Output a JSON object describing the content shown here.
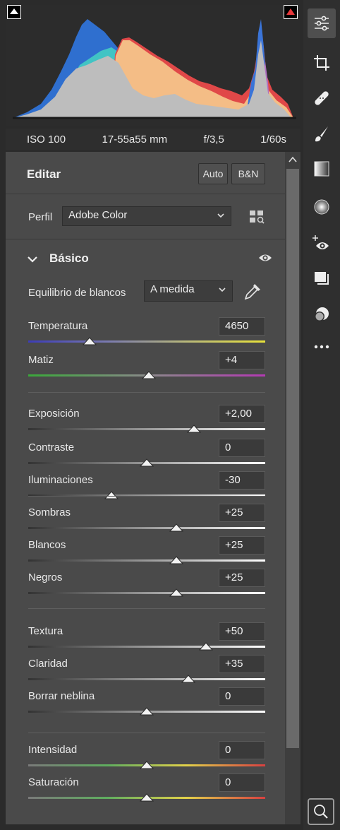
{
  "histogram": {
    "clip_shadow_icon": "triangle-icon",
    "clip_highlight_icon": "triangle-icon",
    "highlight_clip_color": "#e8383b"
  },
  "camera": {
    "iso": "ISO 100",
    "lens": "17-55a55 mm",
    "aperture": "f/3,5",
    "shutter": "1/60s"
  },
  "edit": {
    "title": "Editar",
    "auto_label": "Auto",
    "bw_label": "B&N"
  },
  "profile": {
    "label": "Perfil",
    "value": "Adobe Color"
  },
  "basic": {
    "title": "Básico",
    "wb_label": "Equilibrio de blancos",
    "wb_value": "A medida",
    "sliders": [
      {
        "label": "Temperatura",
        "value": "4650",
        "level": 0.26
      },
      {
        "label": "Matiz",
        "value": "+4",
        "level": 0.51
      },
      {
        "label": "Exposición",
        "value": "+2,00",
        "level": 0.7
      },
      {
        "label": "Contraste",
        "value": "0",
        "level": 0.5
      },
      {
        "label": "Iluminaciones",
        "value": "-30",
        "level": 0.35
      },
      {
        "label": "Sombras",
        "value": "+25",
        "level": 0.625
      },
      {
        "label": "Blancos",
        "value": "+25",
        "level": 0.625
      },
      {
        "label": "Negros",
        "value": "+25",
        "level": 0.625
      },
      {
        "label": "Textura",
        "value": "+50",
        "level": 0.75
      },
      {
        "label": "Claridad",
        "value": "+35",
        "level": 0.675
      },
      {
        "label": "Borrar neblina",
        "value": "0",
        "level": 0.5
      },
      {
        "label": "Intensidad",
        "value": "0",
        "level": 0.5
      },
      {
        "label": "Saturación",
        "value": "0",
        "level": 0.5
      }
    ]
  },
  "toolbar": [
    "edit-sliders-icon",
    "crop-icon",
    "healing-icon",
    "brush-icon",
    "linear-gradient-icon",
    "radial-gradient-icon",
    "red-eye-icon",
    "presets-icon",
    "snapshots-icon",
    "more-icon",
    "zoom-icon"
  ]
}
